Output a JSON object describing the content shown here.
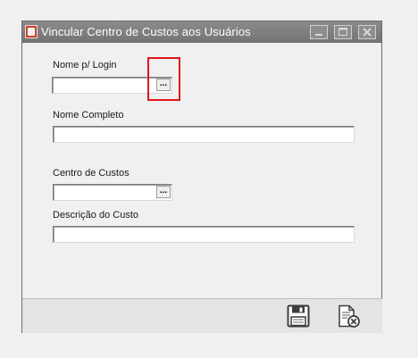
{
  "window": {
    "title": "Vincular Centro de Custos aos Usuários"
  },
  "form": {
    "login_label": "Nome p/ Login",
    "login_value": "",
    "lookup_label": "...",
    "full_name_label": "Nome Completo",
    "full_name_value": "",
    "cost_center_label": "Centro de Custos",
    "cost_center_value": "",
    "cost_description_label": "Descrição do Custo",
    "cost_description_value": ""
  },
  "icons": {
    "app": "app-icon",
    "minimize": "minimize-icon",
    "maximize": "maximize-icon",
    "close": "close-icon",
    "save": "save-icon",
    "cancel": "cancel-document-icon"
  },
  "colors": {
    "titlebar": "#7d7d7d",
    "highlight": "#e0161b"
  }
}
